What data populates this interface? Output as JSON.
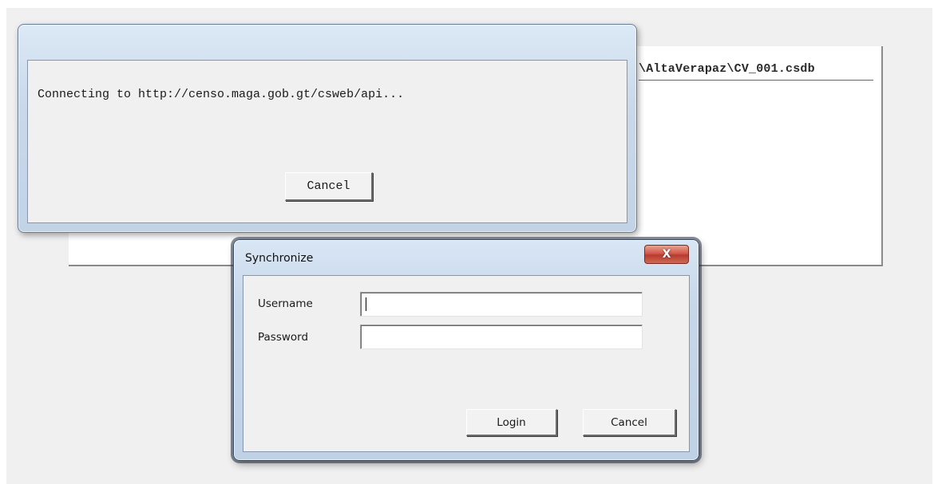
{
  "background_window": {
    "file_path": "\\AltaVerapaz\\CV_001.csdb"
  },
  "connecting_dialog": {
    "message": "Connecting to http://censo.maga.gob.gt/csweb/api...",
    "cancel_label": "Cancel"
  },
  "sync_dialog": {
    "title": "Synchronize",
    "close_glyph": "X",
    "username_label": "Username",
    "username_value": "",
    "password_label": "Password",
    "password_value": "",
    "login_label": "Login",
    "cancel_label": "Cancel"
  }
}
